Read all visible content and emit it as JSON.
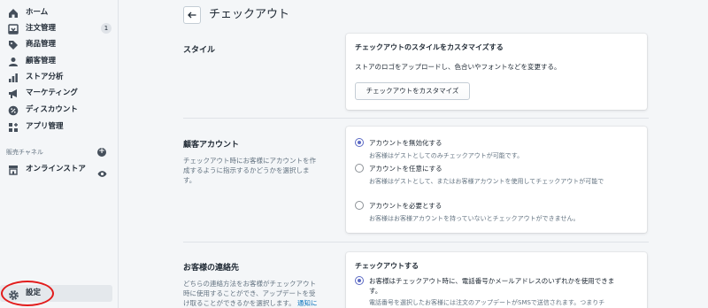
{
  "sidebar": {
    "items": [
      {
        "label": "ホーム",
        "icon": "home-icon"
      },
      {
        "label": "注文管理",
        "icon": "orders-icon",
        "badge": "1"
      },
      {
        "label": "商品管理",
        "icon": "tag-icon"
      },
      {
        "label": "顧客管理",
        "icon": "person-icon"
      },
      {
        "label": "ストア分析",
        "icon": "bar-chart-icon"
      },
      {
        "label": "マーケティング",
        "icon": "megaphone-icon"
      },
      {
        "label": "ディスカウント",
        "icon": "discount-icon"
      },
      {
        "label": "アプリ管理",
        "icon": "apps-icon"
      }
    ],
    "sales_channels_label": "販売チャネル",
    "channels": [
      {
        "label": "オンラインストア",
        "icon": "store-icon"
      }
    ],
    "settings_label": "設定"
  },
  "page": {
    "title": "チェックアウト"
  },
  "sections": {
    "style": {
      "title": "スタイル",
      "card_title": "チェックアウトのスタイルをカスタマイズする",
      "card_text": "ストアのロゴをアップロードし、色合いやフォントなどを変更する。",
      "button_label": "チェックアウトをカスタマイズ"
    },
    "accounts": {
      "title": "顧客アカウント",
      "desc_lines": [
        "チェックアウト時にお客様にアカウントを作",
        "成するように指示するかどうかを選択しま",
        "す。"
      ],
      "options": [
        {
          "label": "アカウントを無効化する",
          "help": "お客様はゲストとしてのみチェックアウトが可能です。",
          "checked": true
        },
        {
          "label": "アカウントを任意にする",
          "help": "お客様はゲストとして、またはお客様アカウントを使用してチェックアウトが可能で",
          "checked": false
        },
        {
          "label": "アカウントを必要とする",
          "help": "お客様はお客様アカウントを持っていないとチェックアウトができません。",
          "checked": false
        }
      ]
    },
    "contact": {
      "title": "お客様の連絡先",
      "desc_lines": [
        "どちらの連絡方法をお客様がチェックアウト",
        "時に使用することができ、アップデートを受",
        "け取ることができるかを選択します。"
      ],
      "desc_link": "通知に",
      "card_title": "チェックアウトする",
      "option_label_lines": [
        "お客様はチェックアウト時に、電話番号かメールアドレスのいずれかを使用できま",
        "す。"
      ],
      "option_help": "電話番号を選択したお客様には注文のアップデートがSMSで送信されます。つまりチ"
    }
  },
  "colors": {
    "accent": "#5c6ac4",
    "link": "#006fbb",
    "highlight_circle": "#e21c1c"
  }
}
